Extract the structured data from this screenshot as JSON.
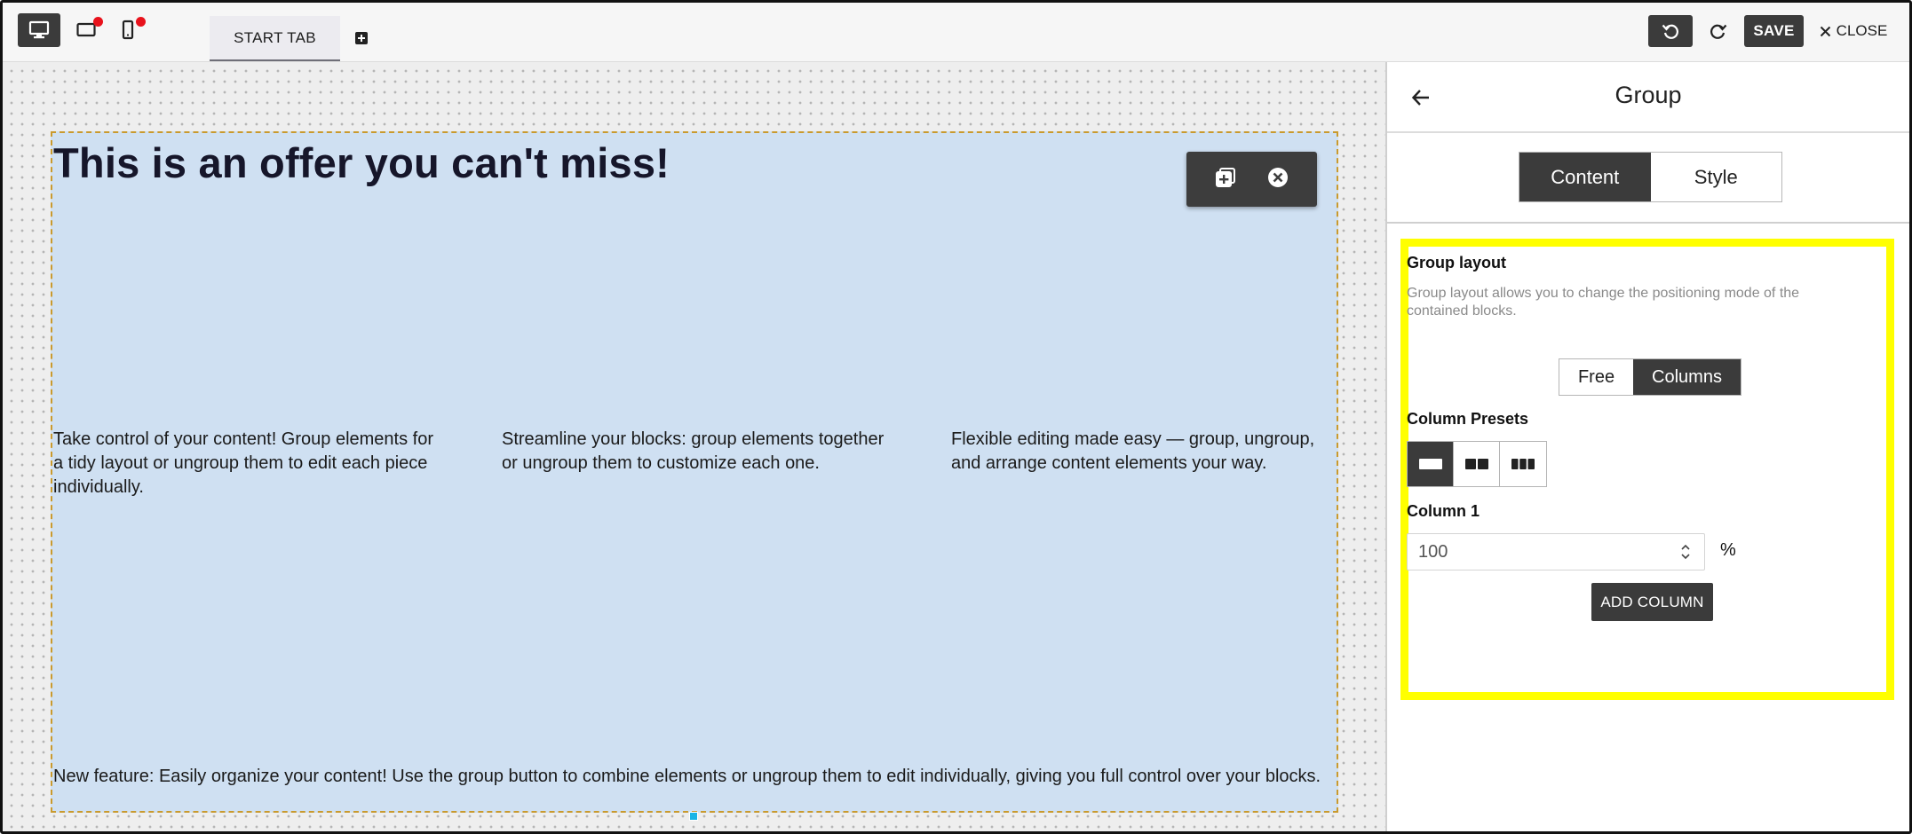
{
  "topbar": {
    "devices": [
      {
        "name": "desktop-icon",
        "active": true,
        "notification": false
      },
      {
        "name": "tablet-icon",
        "active": false,
        "notification": true
      },
      {
        "name": "mobile-icon",
        "active": false,
        "notification": true
      }
    ],
    "tab_label": "START TAB",
    "save_label": "SAVE",
    "close_label": "CLOSE"
  },
  "canvas": {
    "title": "This is an offer you can't miss!",
    "columns": [
      "Take control of your content! Group elements for a tidy layout or ungroup them to edit each piece individually.",
      "Streamline your blocks: group elements together or ungroup them to customize each one.",
      "Flexible editing made easy — group, ungroup, and arrange content elements your way."
    ],
    "bottom_text": "New feature: Easily organize your content! Use the group button to combine elements or ungroup them to edit individually, giving you full control over your blocks.",
    "block_background": "#cfe0f2",
    "outline_color": "#c99a2e"
  },
  "panel": {
    "title": "Group",
    "tabs": [
      {
        "label": "Content",
        "active": true
      },
      {
        "label": "Style",
        "active": false
      }
    ],
    "group_layout": {
      "label": "Group layout",
      "description": "Group layout allows you to change the positioning mode of the contained blocks.",
      "options": [
        "Free",
        "Columns"
      ],
      "selected": "Columns"
    },
    "column_presets": {
      "label": "Column Presets",
      "presets": [
        1,
        2,
        3
      ],
      "selected": 1
    },
    "column_1": {
      "label": "Column 1",
      "value": "100",
      "unit": "%"
    },
    "add_column_label": "ADD COLUMN",
    "highlight_color": "#ffff00"
  },
  "colors": {
    "dark_button": "#3b3b3b",
    "notification": "#e8121c",
    "selection_handle": "#18b4e6"
  }
}
